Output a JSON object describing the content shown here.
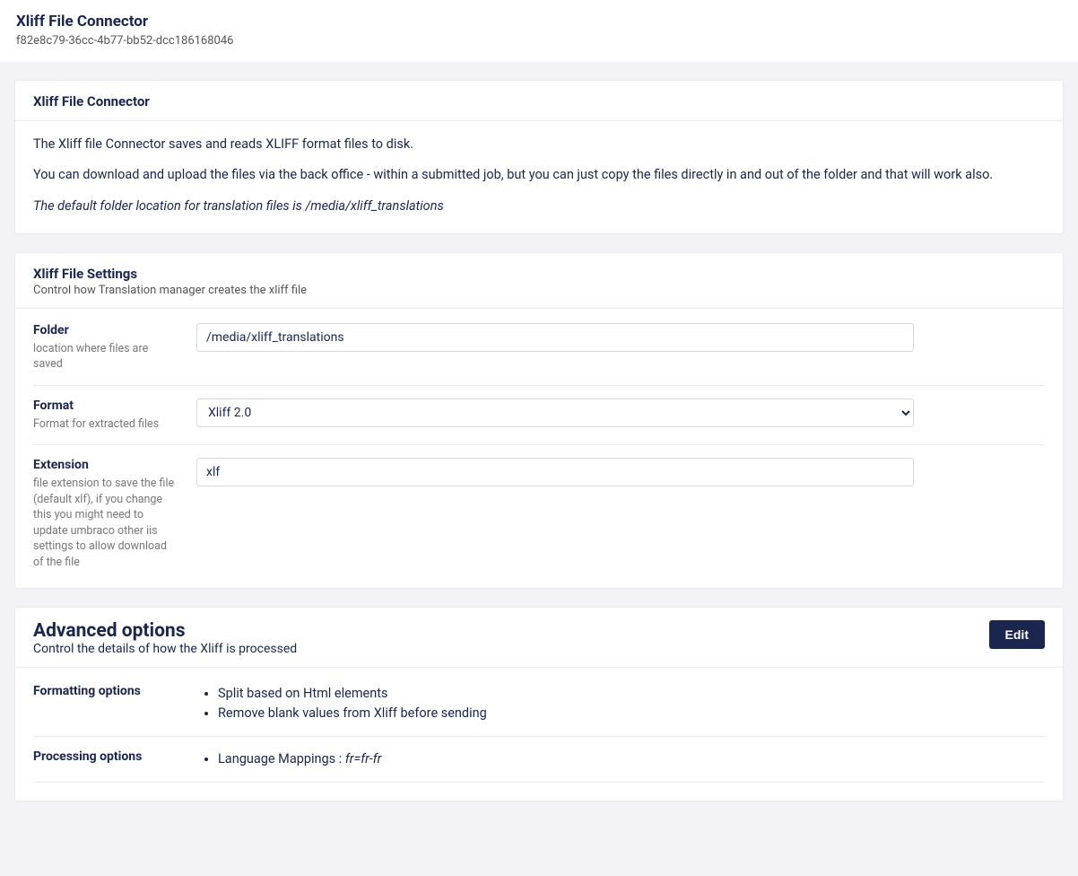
{
  "header": {
    "title": "Xliff File Connector",
    "id": "f82e8c79-36cc-4b77-bb52-dcc186168046"
  },
  "intro": {
    "title": "Xliff File Connector",
    "p1": "The Xliff file Connector saves and reads XLIFF format files to disk.",
    "p2": "You can download and upload the files via the back office - within a submitted job, but you can just copy the files directly in and out of the folder and that will work also.",
    "p3": "The default folder location for translation files is /media/xliff_translations"
  },
  "settings": {
    "title": "Xliff File Settings",
    "desc": "Control how Translation manager creates the xliff file",
    "folder": {
      "label": "Folder",
      "help": "location where files are saved",
      "value": "/media/xliff_translations"
    },
    "format": {
      "label": "Format",
      "help": "Format for extracted files",
      "value": "Xliff 2.0"
    },
    "extension": {
      "label": "Extension",
      "help": "file extension to save the file (default xlf), if you change this you might need to update umbraco other iis settings to allow download of the file",
      "value": "xlf"
    }
  },
  "advanced": {
    "title": "Advanced options",
    "desc": "Control the details of how the Xliff is processed",
    "edit_label": "Edit",
    "formatting": {
      "label": "Formatting options",
      "items": [
        "Split based on Html elements",
        "Remove blank values from Xliff before sending"
      ]
    },
    "processing": {
      "label": "Processing options",
      "mapping_prefix": "Language Mappings : ",
      "mapping_value": "fr=fr-fr"
    }
  }
}
